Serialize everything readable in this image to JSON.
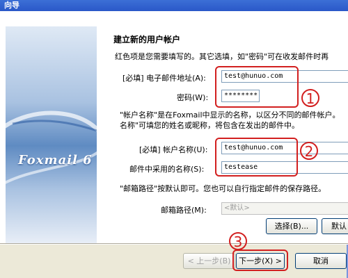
{
  "window": {
    "title": "向导"
  },
  "branding": {
    "logo_text": "Foxmail 6"
  },
  "page": {
    "heading": "建立新的用户帐户",
    "intro": "红色项是您需要填写的。其它选填，如\"密码\"可在收发邮件时再"
  },
  "email": {
    "label": "[必填] 电子邮件地址(A):",
    "value": "test@hunuo.com"
  },
  "password": {
    "label": "密码(W):",
    "value": "********"
  },
  "account_note": {
    "line1": "\"帐户名称\"是在Foxmail中显示的名称，以区分不同的邮件帐户。",
    "line2": "名称\"可填您的姓名或昵称，将包含在发出的邮件中。"
  },
  "account_name": {
    "label": "[必填] 帐户名称(U):",
    "value": "test@hunuo.com"
  },
  "display_name": {
    "label": "邮件中采用的名称(S):",
    "value": "testease"
  },
  "path_note": "\"邮箱路径\"按默认即可。您也可以自行指定邮件的保存路径。",
  "mailbox_path": {
    "label": "邮箱路径(M):",
    "value": "<默认>"
  },
  "buttons": {
    "choose": "选择(B)...",
    "default": "默认",
    "back": "< 上一步(B)",
    "next": "下一步(X) >",
    "cancel": "取消"
  },
  "markers": {
    "m1": "1",
    "m2": "2",
    "m3": "3"
  },
  "colors": {
    "annotation": "#d21f1f",
    "titlebar": "#2a58c8"
  }
}
